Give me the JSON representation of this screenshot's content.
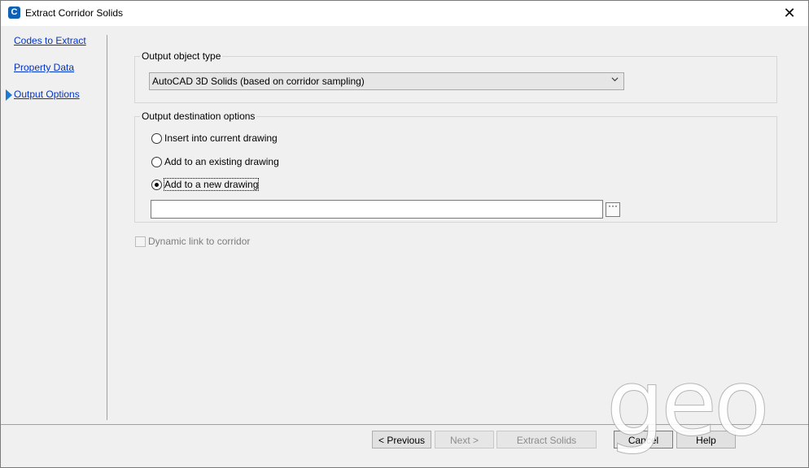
{
  "window": {
    "title": "Extract Corridor Solids",
    "app_icon_glyph": "C",
    "close_glyph": "✕"
  },
  "nav": {
    "items": [
      {
        "label": "Codes to Extract",
        "active": false
      },
      {
        "label": "Property Data",
        "active": false
      },
      {
        "label": "Output Options",
        "active": true
      }
    ]
  },
  "output_object_type": {
    "group_label": "Output object type",
    "selected": "AutoCAD 3D Solids (based on corridor sampling)"
  },
  "output_destination": {
    "group_label": "Output destination options",
    "options": [
      {
        "label": "Insert into current drawing",
        "checked": false
      },
      {
        "label": "Add to an existing drawing",
        "checked": false
      },
      {
        "label": "Add to a new drawing",
        "checked": true
      }
    ],
    "path_value": "",
    "browse_glyph": "···"
  },
  "dynamic_link": {
    "label": "Dynamic link to corridor",
    "checked": false,
    "enabled": false
  },
  "buttons": {
    "previous": "< Previous",
    "next": "Next >",
    "extract": "Extract Solids",
    "cancel": "Cancel",
    "help": "Help"
  },
  "watermark": {
    "text": "geo"
  },
  "colors": {
    "link": "#0033cc",
    "accent": "#1d7bd4",
    "disabled_text": "#8c8c8c"
  }
}
